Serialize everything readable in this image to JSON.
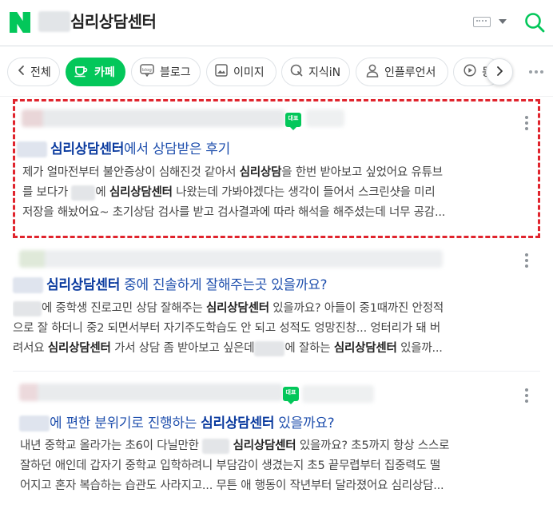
{
  "header": {
    "query": "심리상담센터",
    "logo_letter": "N"
  },
  "tabs": [
    {
      "label": "전체",
      "icon": "chevron-left-icon"
    },
    {
      "label": "카페",
      "icon": "cafe-cup-icon",
      "active": true
    },
    {
      "label": "블로그",
      "icon": "blog-icon"
    },
    {
      "label": "이미지",
      "icon": "image-icon"
    },
    {
      "label": "지식iN",
      "icon": "kin-q-icon"
    },
    {
      "label": "인플루언서",
      "icon": "person-icon"
    },
    {
      "label": "동영상",
      "icon": "play-icon"
    }
  ],
  "colors": {
    "brand": "#03c75a",
    "link": "#1f4fad",
    "highlight_border": "#e0242d"
  },
  "results": [
    {
      "badge": "대표",
      "title_prefix": "",
      "title_highlight": "심리상담센터",
      "title_suffix": "에서 상담받은 후기",
      "lines": [
        {
          "segments": [
            {
              "t": "제가 얼마전부터 불안증상이 심해진것 같아서 "
            },
            {
              "t": "심리상담",
              "b": true
            },
            {
              "t": "을 한번 받아보고 싶었어요 유튜브"
            }
          ]
        },
        {
          "segments": [
            {
              "t": "를 보다가 "
            },
            {
              "blur": 30
            },
            {
              "t": "에 "
            },
            {
              "t": "심리상담센터",
              "b": true
            },
            {
              "t": " 나왔는데 가봐야겠다는 생각이 들어서 스크린샷을 미리"
            }
          ]
        },
        {
          "segments": [
            {
              "t": "저장을 해놨어요~ 초기상담 검사를 받고 검사결과에 따라 해석을 해주셨는데 너무 공감..."
            }
          ]
        }
      ]
    },
    {
      "badge": "",
      "title_prefix": "",
      "title_highlight": "심리상담센터",
      "title_suffix": " 중에 진솔하게 잘해주는곳 있을까요?",
      "lines": [
        {
          "segments": [
            {
              "blur": 36
            },
            {
              "t": "에 중학생 진로고민 상담 잘해주는 "
            },
            {
              "t": "심리상담센터",
              "b": true
            },
            {
              "t": " 있을까요? 아들이 중1때까진 안정적"
            }
          ]
        },
        {
          "segments": [
            {
              "t": "으로 잘 하더니 중2 되면서부터 자기주도학습도 안 되고 성적도 엉망진창... 엉터리가 돼 버"
            }
          ]
        },
        {
          "segments": [
            {
              "t": "려서요 "
            },
            {
              "t": "심리상담센터",
              "b": true
            },
            {
              "t": " 가서 상담 좀 받아보고 싶은데"
            },
            {
              "blur": 38
            },
            {
              "t": "에 잘하는 "
            },
            {
              "t": "심리상담센터",
              "b": true
            },
            {
              "t": " 있을까..."
            }
          ]
        }
      ]
    },
    {
      "badge": "대표",
      "title_prefix": "에 편한 분위기로 진행하는 ",
      "title_highlight": "심리상담센터",
      "title_suffix": " 있을까요?",
      "lines": [
        {
          "segments": [
            {
              "t": "내년 중학교 올라가는 초6이 다닐만한 "
            },
            {
              "blur": 34
            },
            {
              "t": " "
            },
            {
              "t": "심리상담센터",
              "b": true
            },
            {
              "t": " 있을까요? 초5까지 항상 스스로"
            }
          ]
        },
        {
          "segments": [
            {
              "t": "잘하던 애인데 갑자기 중학교 입학하려니 부담감이 생겼는지 초5 끝무렵부터 집중력도 떨"
            }
          ]
        },
        {
          "segments": [
            {
              "t": "어지고 혼자 복습하는 습관도 사라지고... 무튼 애 행동이 작년부터 달라졌어요 심리상담..."
            }
          ]
        }
      ]
    }
  ]
}
